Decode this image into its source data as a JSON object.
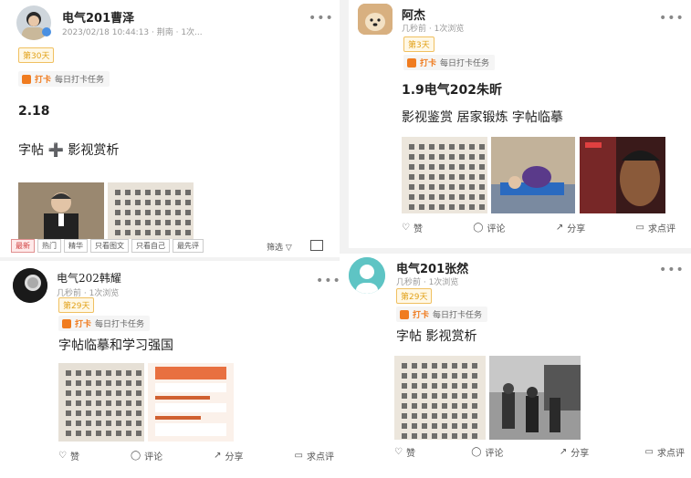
{
  "cards": [
    {
      "id": "caoze",
      "username": "电气201曹泽",
      "meta": "2023/02/18 10:44:13 · 荆南 · 1次...",
      "badge": "第30天",
      "task_icon_label": "打卡",
      "task_label": "每日打卡任务",
      "title": "2.18",
      "body": "字帖 ➕ 影视赏析",
      "tags": [
        "最新",
        "热门",
        "精华",
        "只看图文",
        "只看自己",
        "最先评"
      ],
      "filter_label": "筛选",
      "filter_icon": "funnel-icon"
    },
    {
      "id": "ajie",
      "username": "阿杰",
      "meta": "几秒前 · 1次浏览",
      "badge": "第3天",
      "task_icon_label": "打卡",
      "task_label": "每日打卡任务",
      "title": "1.9电气202朱昕",
      "body": "影视鉴赏 居家锻炼 字帖临摹",
      "actions": {
        "like": "赞",
        "comment": "评论",
        "share": "分享",
        "review": "求点评"
      }
    },
    {
      "id": "hanyao",
      "username": "电气202韩耀",
      "meta": "几秒前 · 1次浏览",
      "badge": "第29天",
      "task_icon_label": "打卡",
      "task_label": "每日打卡任务",
      "body": "字帖临摹和学习强国",
      "actions": {
        "like": "赞",
        "comment": "评论",
        "share": "分享",
        "review": "求点评"
      }
    },
    {
      "id": "zhangran",
      "username": "电气201张然",
      "meta": "几秒前 · 1次浏览",
      "badge": "第29天",
      "task_icon_label": "打卡",
      "task_label": "每日打卡任务",
      "body": "字帖 影视赏析",
      "actions": {
        "like": "赞",
        "comment": "评论",
        "share": "分享",
        "review": "求点评"
      }
    }
  ],
  "colors": {
    "accent": "#f07c20",
    "badge": "#e2a21a",
    "avatar_teal": "#5ec4c4"
  }
}
